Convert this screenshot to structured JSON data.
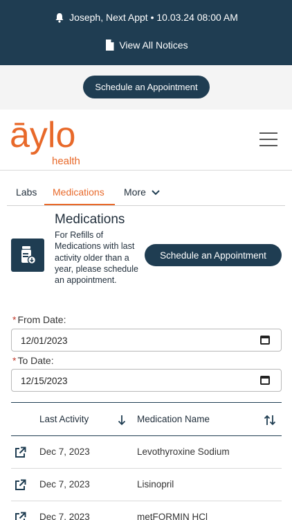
{
  "notice_bar": {
    "appointment_text": "Joseph, Next Appt • 10.03.24 08:00 AM",
    "view_notices_label": "View All Notices"
  },
  "cta": {
    "schedule_label": "Schedule an Appointment"
  },
  "header": {
    "logo_text": "āylo",
    "logo_subtext": "health",
    "brand_color": "#e8692a",
    "menu_icon": "hamburger-icon"
  },
  "tabs": [
    {
      "label": "Labs",
      "active": false
    },
    {
      "label": "Medications",
      "active": true
    },
    {
      "label": "More",
      "active": false
    }
  ],
  "medications": {
    "title": "Medications",
    "description": "For Refills of Medications with last activity older than a year, please schedule an appointment.",
    "schedule_label": "Schedule an Appointment",
    "icon": "pill-bottle-download-icon"
  },
  "filters": {
    "from_label": "From Date:",
    "from_value": "12/01/2023",
    "to_label": "To Date:",
    "to_value": "12/15/2023",
    "required_mark": "*"
  },
  "table": {
    "columns": [
      "Last Activity",
      "Medication Name"
    ],
    "rows": [
      {
        "date": "Dec 7, 2023",
        "name": "Levothyroxine Sodium"
      },
      {
        "date": "Dec 7, 2023",
        "name": "Lisinopril"
      },
      {
        "date": "Dec 7, 2023",
        "name": "metFORMIN HCl"
      }
    ]
  },
  "colors": {
    "navy": "#1f3d52",
    "accent_orange": "#e8692a",
    "required_red": "#c0392b"
  }
}
